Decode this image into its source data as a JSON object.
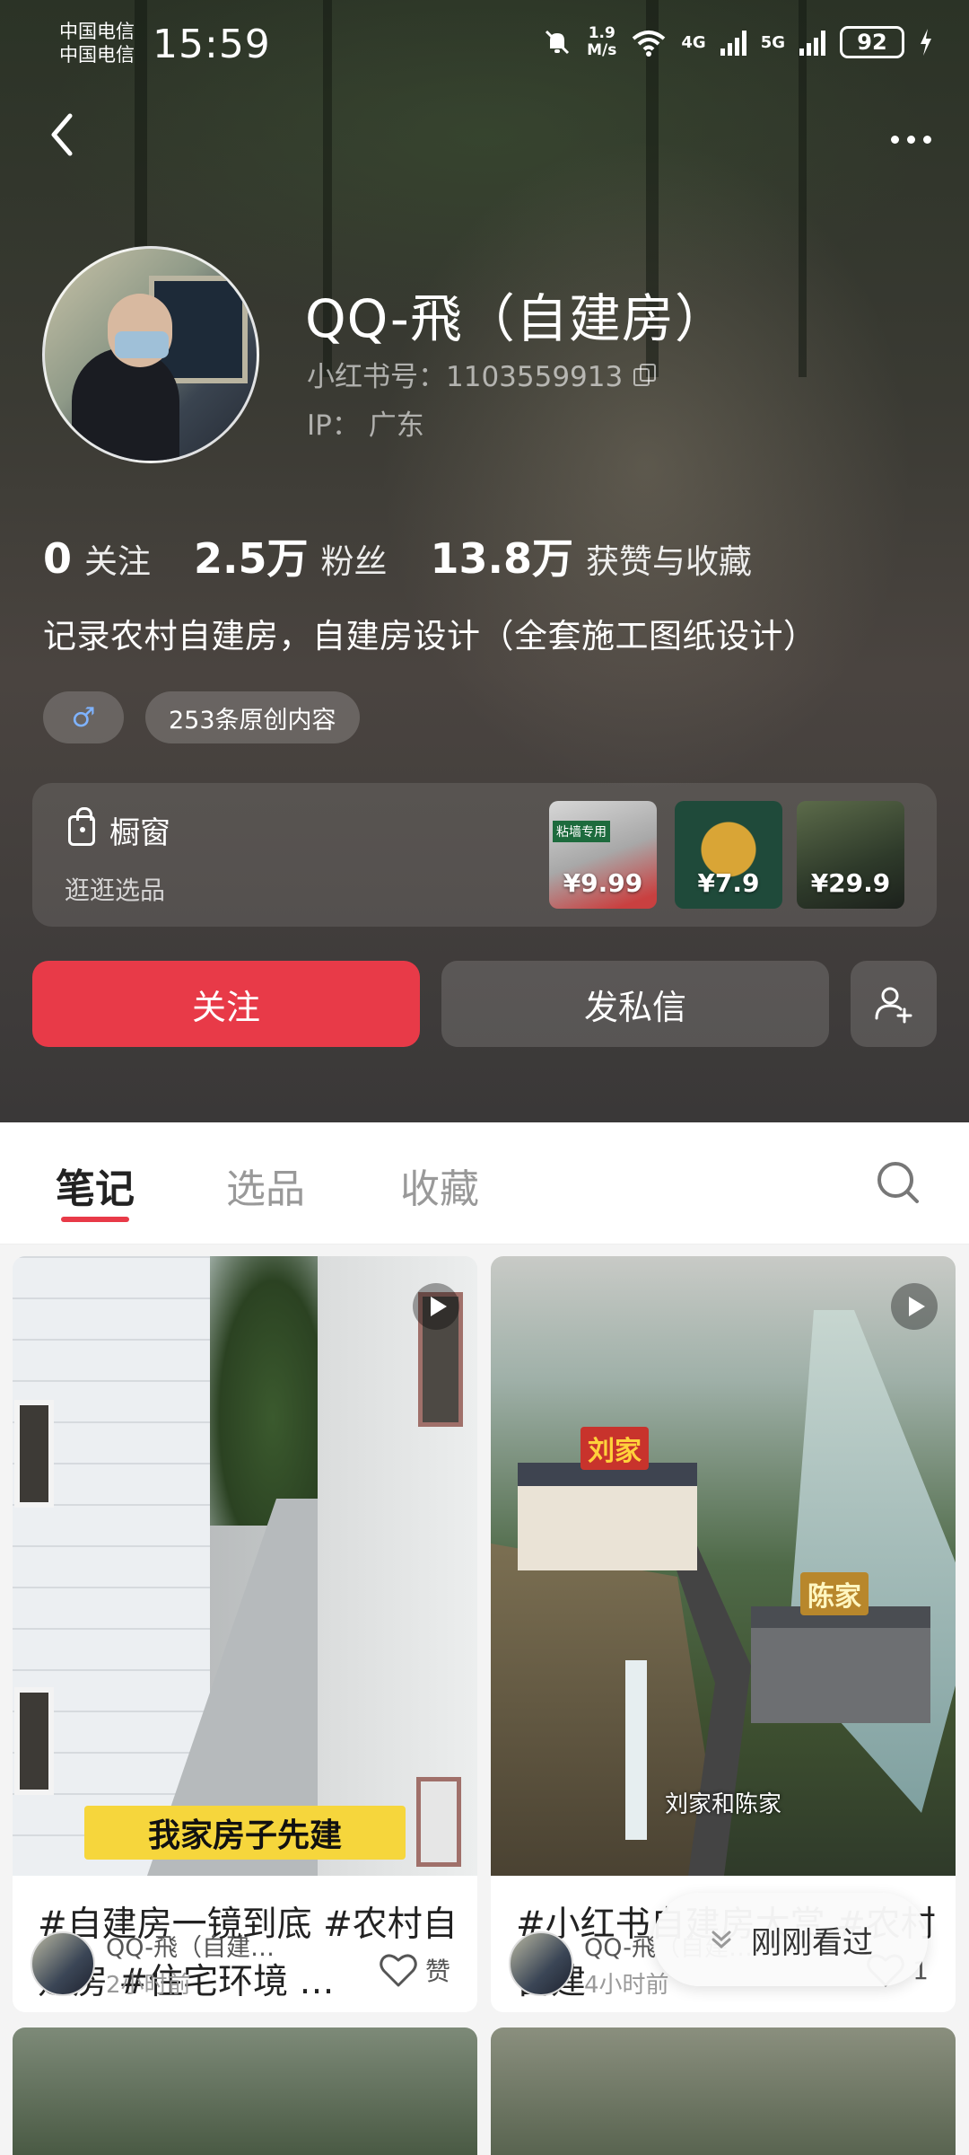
{
  "status_bar": {
    "carrier_1": "中国电信",
    "carrier_2": "中国电信",
    "time": "15:59",
    "speed_value": "1.9",
    "speed_unit": "M/s",
    "network_1": "4G",
    "network_2": "5G",
    "battery": "92"
  },
  "profile": {
    "nickname": "QQ-飛（自建房）",
    "redbook_id_label": "小红书号：",
    "redbook_id": "1103559913",
    "ip_label": "IP：",
    "ip": "广东",
    "stats": [
      {
        "num": "0",
        "label": "关注"
      },
      {
        "num": "2.5万",
        "label": "粉丝"
      },
      {
        "num": "13.8万",
        "label": "获赞与收藏"
      }
    ],
    "bio": "记录农村自建房，自建房设计（全套施工图纸设计）",
    "gender_tag": "♂",
    "content_tag": "253条原创内容"
  },
  "shop": {
    "title": "橱窗",
    "subtitle": "逛逛选品",
    "products": [
      {
        "price": "¥9.99",
        "label": "粘墙专用"
      },
      {
        "price": "¥7.9"
      },
      {
        "price": "¥29.9"
      }
    ]
  },
  "actions": {
    "follow": "关注",
    "message": "发私信"
  },
  "tabs": {
    "notes": "笔记",
    "picks": "选品",
    "favorites": "收藏"
  },
  "feed": [
    {
      "cover_caption": "我家房子先建",
      "title": "#自建房一镜到底 #农村自建房 #住宅环境 …",
      "author": "QQ-飛（自建…",
      "time": "2小时前",
      "likes": "赞"
    },
    {
      "cover_caption": "刘家和陈家",
      "sign_1": "刘家",
      "sign_2": "陈家",
      "title": "#小红书自建房大赏 #农村自建",
      "author": "QQ-飛（自建…",
      "time": "4小时前",
      "likes": "1"
    }
  ],
  "recent_pill": "刚刚看过",
  "icons": {
    "back": "chevron-left-icon",
    "more": "more-dots-icon",
    "copy": "copy-icon",
    "shop": "bag-icon",
    "add_friend": "add-user-icon",
    "search": "search-icon",
    "play": "play-icon",
    "like": "heart-icon",
    "collapse": "chevron-down-icon"
  },
  "colors": {
    "accent": "#e83a48",
    "header_bg": "#3a3a36"
  }
}
